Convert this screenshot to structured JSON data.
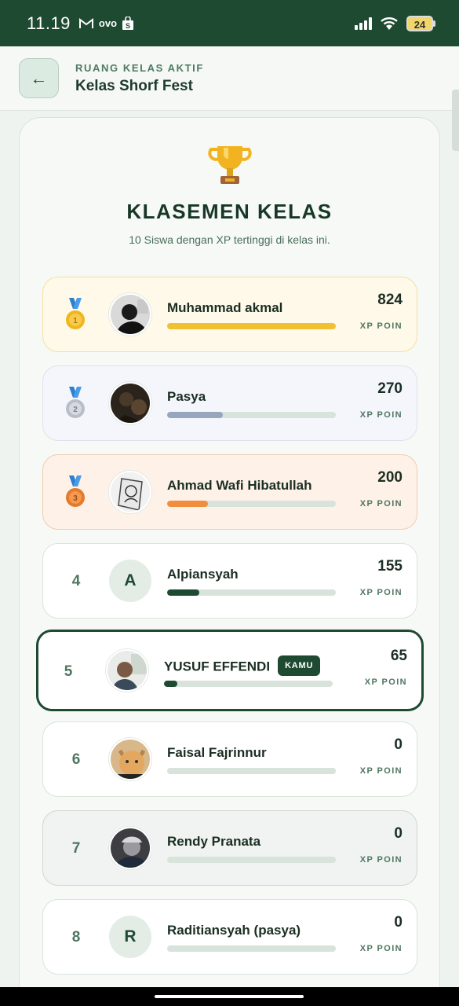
{
  "status_bar": {
    "time": "11.19",
    "notif_text": "ovo",
    "battery": "24"
  },
  "header": {
    "back_label": "←",
    "kicker": "RUANG KELAS AKTIF",
    "title": "Kelas Shorf Fest"
  },
  "leaderboard": {
    "title": "KLASEMEN KELAS",
    "subtitle": "10 Siswa dengan XP tertinggi di kelas ini.",
    "xp_label": "XP POIN",
    "you_badge": "KAMU",
    "entries": [
      {
        "rank": "1",
        "medal": "gold",
        "name": "Muhammad akmal",
        "score": "824",
        "progress": 1.0,
        "bar_color": "#f2c033"
      },
      {
        "rank": "2",
        "medal": "silver",
        "name": "Pasya",
        "score": "270",
        "progress": 0.33,
        "bar_color": "#97a6bd"
      },
      {
        "rank": "3",
        "medal": "bronze",
        "name": "Ahmad Wafi Hibatullah",
        "score": "200",
        "progress": 0.24,
        "bar_color": "#f08e3e"
      },
      {
        "rank": "4",
        "name": "Alpiansyah",
        "initial": "A",
        "score": "155",
        "progress": 0.19,
        "bar_color": "#1e4a32"
      },
      {
        "rank": "5",
        "name": "YUSUF EFFENDI",
        "score": "65",
        "progress": 0.08,
        "bar_color": "#1e4a32"
      },
      {
        "rank": "6",
        "name": "Faisal Fajrinnur",
        "score": "0",
        "progress": 0
      },
      {
        "rank": "7",
        "name": "Rendy Pranata",
        "score": "0",
        "progress": 0
      },
      {
        "rank": "8",
        "name": "Raditiansyah (pasya)",
        "initial": "R",
        "score": "0",
        "progress": 0
      }
    ]
  }
}
